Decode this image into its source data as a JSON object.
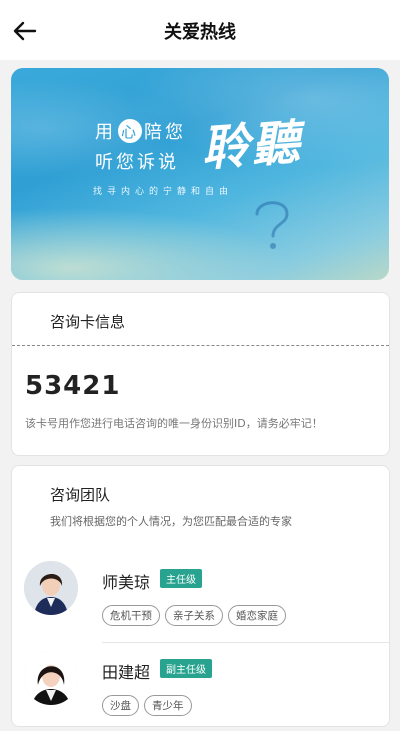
{
  "header": {
    "title": "关爱热线"
  },
  "banner": {
    "line1_pre": "用",
    "line1_heart": "心",
    "line1_post": "陪您",
    "line2": "听您诉说",
    "big": "聆聽",
    "sub": "找寻内心的宁静和自由"
  },
  "card_info": {
    "title": "咨询卡信息",
    "number": "53421",
    "note": "该卡号用作您进行电话咨询的唯一身份识别ID，请务必牢记！"
  },
  "team": {
    "title": "咨询团队",
    "subtitle": "我们将根据您的个人情况，为您匹配最合适的专家",
    "experts": [
      {
        "name": "师美琼",
        "level": "主任级",
        "tags": [
          "危机干预",
          "亲子关系",
          "婚恋家庭"
        ]
      },
      {
        "name": "田建超",
        "level": "副主任级",
        "tags": [
          "沙盘",
          "青少年"
        ]
      }
    ]
  }
}
